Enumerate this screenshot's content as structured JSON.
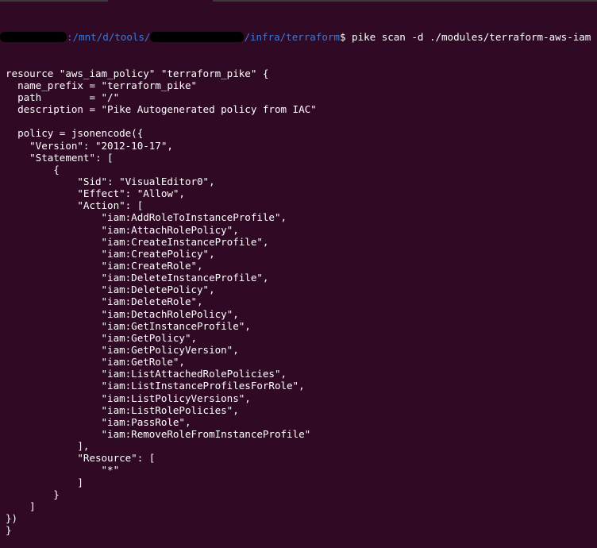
{
  "terminal": {
    "background": "#300a24",
    "foreground": "#ffffff",
    "prompt_path_color": "#3b78d8",
    "prompt": {
      "user_host": "[redacted]",
      "path_prefix": ":/mnt/d/tools/",
      "path_redacted": "[redacted]",
      "path_suffix": "/infra/terraform",
      "symbol": "$",
      "command": " pike scan -d ./modules/terraform-aws-iam"
    },
    "output_lines": [
      "resource \"aws_iam_policy\" \"terraform_pike\" {",
      "  name_prefix = \"terraform_pike\"",
      "  path        = \"/\"",
      "  description = \"Pike Autogenerated policy from IAC\"",
      "",
      "  policy = jsonencode({",
      "    \"Version\": \"2012-10-17\",",
      "    \"Statement\": [",
      "        {",
      "            \"Sid\": \"VisualEditor0\",",
      "            \"Effect\": \"Allow\",",
      "            \"Action\": [",
      "                \"iam:AddRoleToInstanceProfile\",",
      "                \"iam:AttachRolePolicy\",",
      "                \"iam:CreateInstanceProfile\",",
      "                \"iam:CreatePolicy\",",
      "                \"iam:CreateRole\",",
      "                \"iam:DeleteInstanceProfile\",",
      "                \"iam:DeletePolicy\",",
      "                \"iam:DeleteRole\",",
      "                \"iam:DetachRolePolicy\",",
      "                \"iam:GetInstanceProfile\",",
      "                \"iam:GetPolicy\",",
      "                \"iam:GetPolicyVersion\",",
      "                \"iam:GetRole\",",
      "                \"iam:ListAttachedRolePolicies\",",
      "                \"iam:ListInstanceProfilesForRole\",",
      "                \"iam:ListPolicyVersions\",",
      "                \"iam:ListRolePolicies\",",
      "                \"iam:PassRole\",",
      "                \"iam:RemoveRoleFromInstanceProfile\"",
      "            ],",
      "            \"Resource\": [",
      "                \"*\"",
      "            ]",
      "        }",
      "    ]",
      "})",
      "}"
    ]
  }
}
